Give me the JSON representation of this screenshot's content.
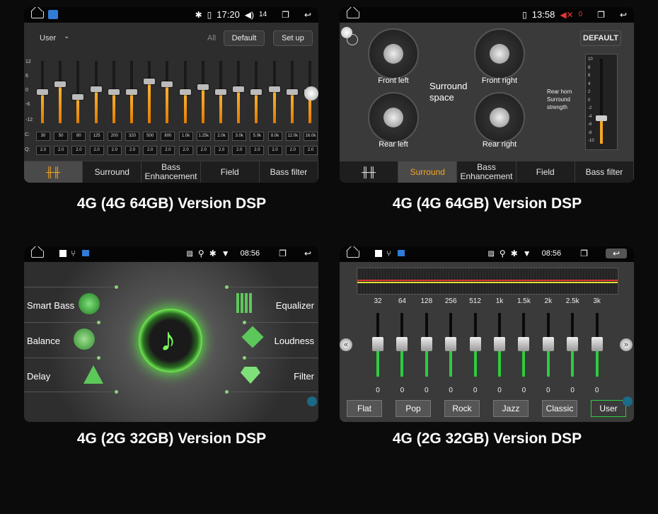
{
  "panel1": {
    "status": {
      "time": "17:20",
      "volume": "14"
    },
    "preset_select": "User",
    "all_label": "All",
    "default_button": "Default",
    "setup_button": "Set up",
    "y_labels": [
      "12",
      "6",
      "0",
      "-6",
      "-12"
    ],
    "row_labels": [
      "C:",
      "Q:"
    ],
    "freqs": [
      "30",
      "50",
      "80",
      "125",
      "200",
      "320",
      "500",
      "800",
      "1.0k",
      "1.25k",
      "2.0k",
      "3.0k",
      "5.0k",
      "8.0k",
      "12.0k",
      "16.0k"
    ],
    "q_values": [
      "2.0",
      "2.0",
      "2.0",
      "2.0",
      "2.0",
      "2.0",
      "2.0",
      "2.0",
      "2.0",
      "2.0",
      "2.0",
      "2.0",
      "2.0",
      "2.0",
      "2.0",
      "2.0"
    ],
    "gains": [
      0,
      3,
      -2,
      1,
      0,
      0,
      4,
      3,
      0,
      2,
      0,
      1,
      0,
      1,
      0,
      0
    ],
    "tabs": [
      "",
      "Surround",
      "Bass\nEnhancement",
      "Field",
      "Bass filter"
    ],
    "caption": "4G (4G 64GB) Version DSP"
  },
  "panel2": {
    "status": {
      "time": "13:58",
      "volume": "0"
    },
    "default_button": "DEFAULT",
    "dials": [
      "Front left",
      "Front right",
      "Rear left",
      "Rear right"
    ],
    "center_label": "Surround\nspace",
    "side_label": "Rear horn\nSurround\nstrength",
    "scale": [
      "10",
      "8",
      "6",
      "4",
      "2",
      "0",
      "-2",
      "-4",
      "-6",
      "-8",
      "-10"
    ],
    "strength": 0.3,
    "tabs": [
      "",
      "Surround",
      "Bass\nEnhancement",
      "Field",
      "Bass filter"
    ],
    "caption": "4G (4G 64GB) Version DSP"
  },
  "panel3": {
    "status": {
      "time": "08:56"
    },
    "left_items": [
      "Smart Bass",
      "Balance",
      "Delay"
    ],
    "right_items": [
      "Equalizer",
      "Loudness",
      "Filter"
    ],
    "caption": "4G (2G 32GB) Version DSP"
  },
  "panel4": {
    "status": {
      "time": "08:56"
    },
    "freqs": [
      "32",
      "64",
      "128",
      "256",
      "512",
      "1k",
      "1.5k",
      "2k",
      "2.5k",
      "3k"
    ],
    "values": [
      "0",
      "0",
      "0",
      "0",
      "0",
      "0",
      "0",
      "0",
      "0",
      "0"
    ],
    "presets": [
      "Flat",
      "Pop",
      "Rock",
      "Jazz",
      "Classic",
      "User"
    ],
    "selected_preset": "User",
    "caption": "4G (2G 32GB) Version DSP"
  },
  "colors": {
    "accent_orange": "#f5a623",
    "accent_green": "#2ecc40"
  }
}
